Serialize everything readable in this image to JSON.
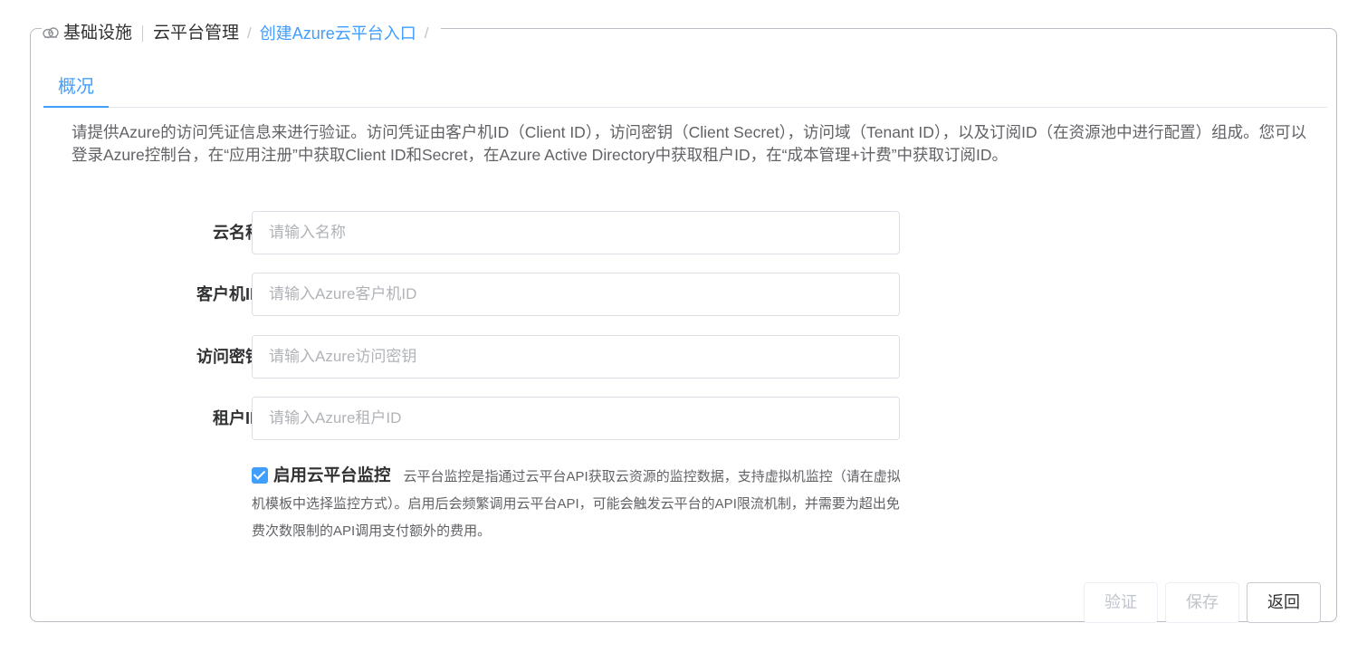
{
  "breadcrumb": {
    "item1": "基础设施",
    "item2": "云平台管理",
    "item3": "创建Azure云平台入口",
    "trailing": "/"
  },
  "tabs": [
    {
      "label": "概况"
    }
  ],
  "description": "请提供Azure的访问凭证信息来进行验证。访问凭证由客户机ID（Client ID），访问密钥（Client Secret），访问域（Tenant ID），以及订阅ID（在资源池中进行配置）组成。您可以登录Azure控制台，在“应用注册”中获取Client ID和Secret，在Azure Active Directory中获取租户ID，在“成本管理+计费”中获取订阅ID。",
  "form": {
    "required_mark": "*",
    "cloud_name": {
      "label": "云名称",
      "placeholder": "请输入名称",
      "value": ""
    },
    "client_id": {
      "label": "客户机ID",
      "placeholder": "请输入Azure客户机ID",
      "value": ""
    },
    "client_secret": {
      "label": "访问密钥",
      "placeholder": "请输入Azure访问密钥",
      "value": ""
    },
    "tenant_id": {
      "label": "租户ID",
      "placeholder": "请输入Azure租户ID",
      "value": ""
    }
  },
  "monitor": {
    "checked": true,
    "label": "启用云平台监控",
    "help": "云平台监控是指通过云平台API获取云资源的监控数据，支持虚拟机监控（请在虚拟机模板中选择监控方式）。启用后会频繁调用云平台API，可能会触发云平台的API限流机制，并需要为超出免费次数限制的API调用支付额外的费用。"
  },
  "buttons": {
    "verify": "验证",
    "save": "保存",
    "back": "返回"
  },
  "colors": {
    "accent": "#409eff",
    "required": "#f56c6c",
    "border": "#dcdfe6"
  }
}
